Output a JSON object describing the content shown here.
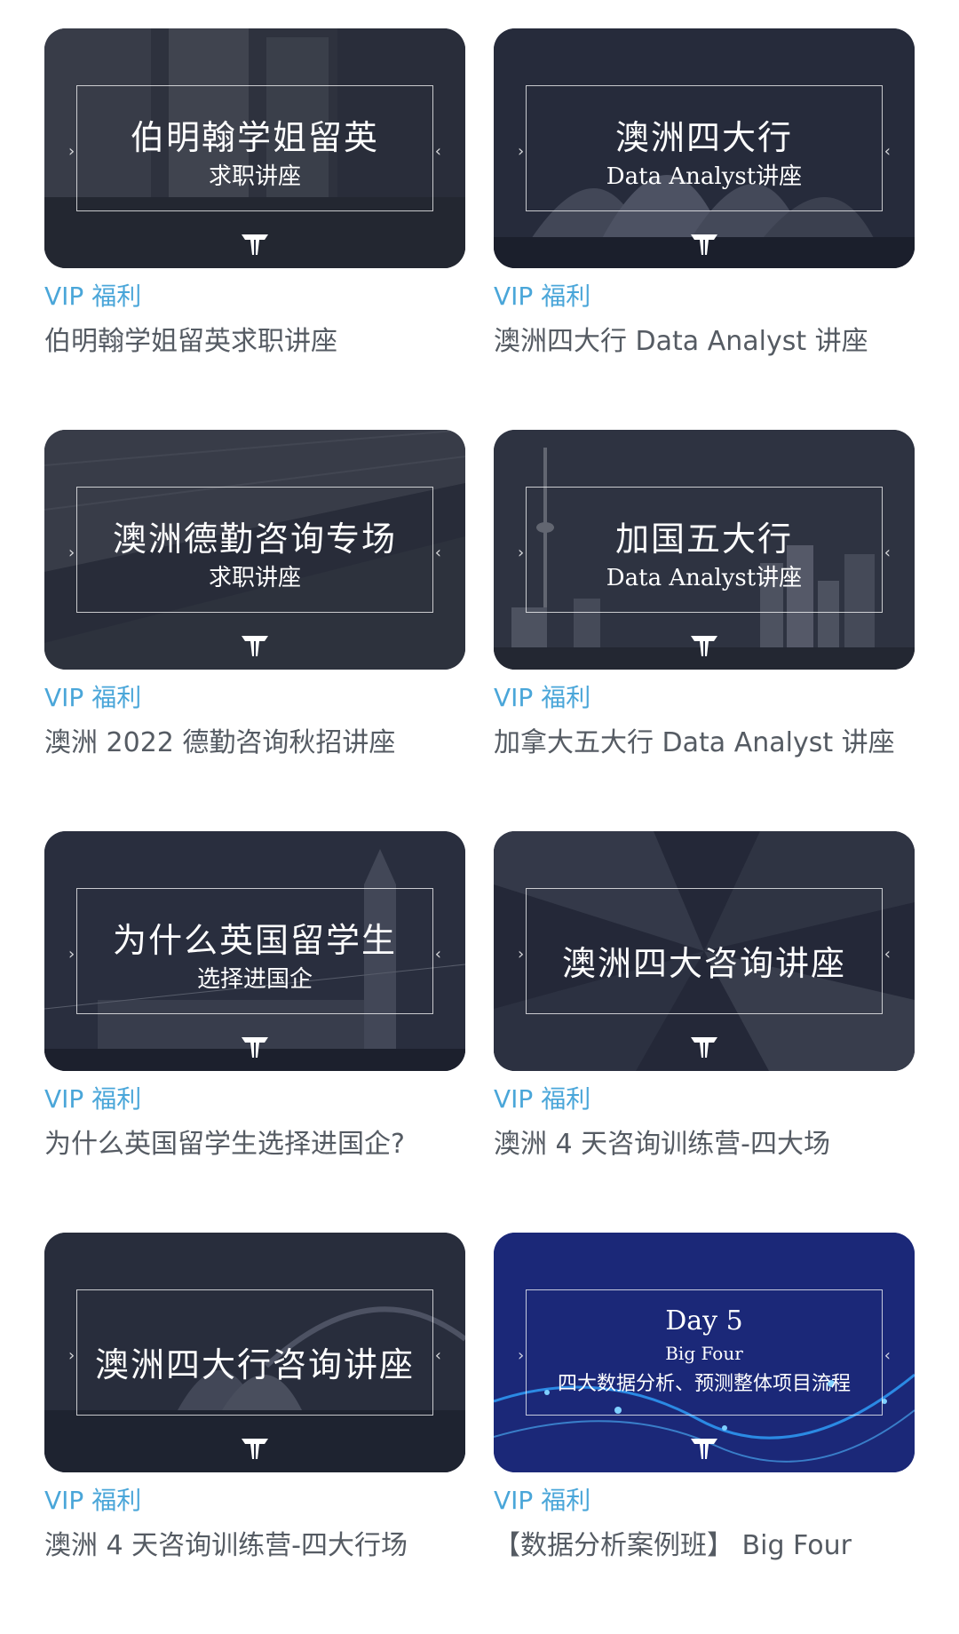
{
  "badge_label": "VIP 福利",
  "colors": {
    "badge": "#4aa6d9",
    "caption": "#555b63",
    "card_dark": "#2b3040",
    "card_blue": "#1e2f8a"
  },
  "cards": [
    {
      "thumb_title": "伯明翰学姐留英",
      "thumb_subtitle": "求职讲座",
      "caption": "伯明翰学姐留英求职讲座"
    },
    {
      "thumb_title": "澳洲四大行",
      "thumb_subtitle": "Data Analyst讲座",
      "caption": "澳洲四大行 Data Analyst 讲座"
    },
    {
      "thumb_title": "澳洲德勤咨询专场",
      "thumb_subtitle": "求职讲座",
      "caption": "澳洲 2022 德勤咨询秋招讲座"
    },
    {
      "thumb_title": "加国五大行",
      "thumb_subtitle": "Data Analyst讲座",
      "caption": "加拿大五大行 Data Analyst 讲座"
    },
    {
      "thumb_title": "为什么英国留学生",
      "thumb_subtitle": "选择进国企",
      "caption": "为什么英国留学生选择进国企?"
    },
    {
      "thumb_title": "澳洲四大咨询讲座",
      "caption": "澳洲 4 天咨询训练营-四大场"
    },
    {
      "thumb_title": "澳洲四大行咨询讲座",
      "caption": "澳洲 4 天咨询训练营-四大行场"
    },
    {
      "thumb_day": "Day 5",
      "thumb_subtitle": "Big Four",
      "thumb_detail": "四大数据分析、预测整体项目流程",
      "caption": "【数据分析案例班】 Big Four"
    }
  ]
}
